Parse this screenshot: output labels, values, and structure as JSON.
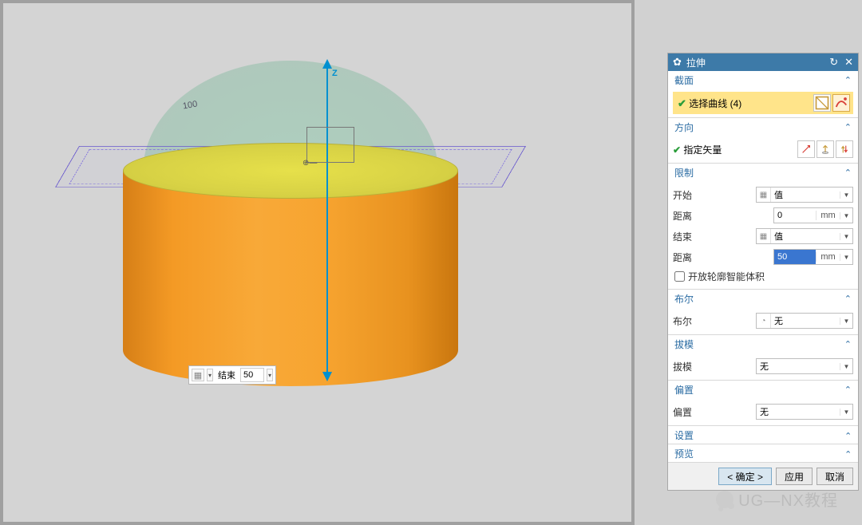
{
  "panel": {
    "title": "拉伸",
    "sections": {
      "section1": {
        "title": "截面",
        "select_label": "选择曲线 (4)"
      },
      "direction": {
        "title": "方向",
        "vector_label": "指定矢量"
      },
      "limits": {
        "title": "限制",
        "start_label": "开始",
        "start_type": "值",
        "start_dist_label": "距离",
        "start_dist_value": "0",
        "end_label": "结束",
        "end_type": "值",
        "end_dist_label": "距离",
        "end_dist_value": "50",
        "unit": "mm",
        "open_profile": "开放轮廓智能体积"
      },
      "boolean": {
        "title": "布尔",
        "label": "布尔",
        "value": "无"
      },
      "draft": {
        "title": "拔模",
        "label": "拔模",
        "value": "无"
      },
      "offset": {
        "title": "偏置",
        "label": "偏置",
        "value": "无"
      },
      "settings": {
        "title": "设置"
      },
      "preview": {
        "title": "预览"
      }
    }
  },
  "buttons": {
    "ok": "< 确定 >",
    "apply": "应用",
    "cancel": "取消"
  },
  "float": {
    "end_label": "结束",
    "value": "50"
  },
  "viewport": {
    "z": "Z",
    "dim": "100"
  },
  "watermark": "UG—NX教程"
}
